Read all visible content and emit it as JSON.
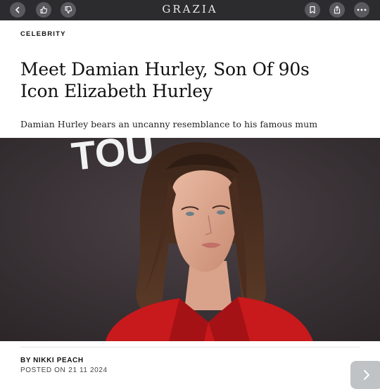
{
  "toolbar": {
    "brand": "GRAZIA",
    "buttons": [
      "back-icon",
      "thumbs-up-icon",
      "thumbs-down-icon",
      "bookmark-icon",
      "share-icon",
      "more-icon"
    ]
  },
  "article": {
    "category": "CELEBRITY",
    "headline": "Meet Damian Hurley, Son Of 90s Icon Elizabeth Hurley",
    "standfirst": "Damian Hurley bears an uncanny resemblance to his famous mum",
    "hero_backdrop_text": "TOU",
    "byline_prefix": "BY",
    "author": "NIKKI PEACH",
    "posted_prefix": "POSTED ON",
    "posted_date": "21 11 2024"
  },
  "colors": {
    "toolbar": "#2c2c2e",
    "accent_red": "#c8191c",
    "text": "#111111"
  }
}
